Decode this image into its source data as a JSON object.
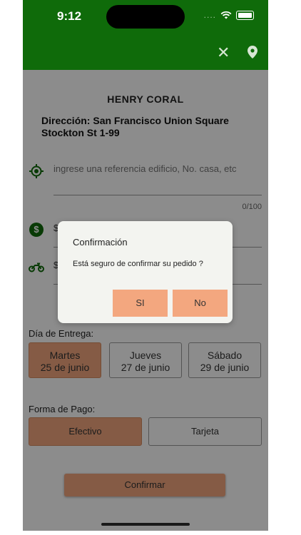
{
  "status_bar": {
    "time": "9:12",
    "signal": "...."
  },
  "header": {
    "close_icon": "close-icon",
    "location_icon": "location-pin-icon",
    "color": "#0f6b0a"
  },
  "customer": {
    "name": "HENRY CORAL",
    "address": "Dirección: San Francisco Union Square Stockton St 1-99"
  },
  "reference": {
    "value": "",
    "placeholder": "ingrese una referencia edificio, No. casa, etc",
    "counter": "0/100"
  },
  "price_field": {
    "prefix": "$"
  },
  "shipping_field": {
    "prefix": "$"
  },
  "delivery": {
    "label": "Día de Entrega:",
    "days": [
      {
        "day": "Martes",
        "date": "25 de junio",
        "selected": true
      },
      {
        "day": "Jueves",
        "date": "27 de junio",
        "selected": false
      },
      {
        "day": "Sábado",
        "date": "29 de junio",
        "selected": false
      }
    ]
  },
  "payment": {
    "label": "Forma de Pago:",
    "options": [
      {
        "label": "Efectivo",
        "selected": true
      },
      {
        "label": "Tarjeta",
        "selected": false
      }
    ]
  },
  "confirm_label": "Confirmar",
  "dialog": {
    "title": "Confirmación",
    "message": "Está seguro de confirmar su pedido ?",
    "yes_label": "SI",
    "no_label": "No"
  },
  "colors": {
    "accent": "#f3a77f",
    "brand_green": "#0f6b0a"
  }
}
